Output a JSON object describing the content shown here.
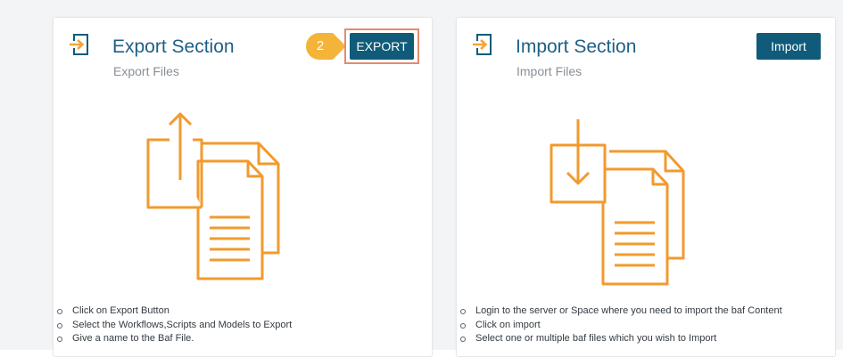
{
  "colors": {
    "title": "#1f5f86",
    "button_bg": "#0f5b79",
    "accent_orange": "#f4a53a",
    "highlight_border": "#e38b70"
  },
  "export_section": {
    "icon": "export-icon",
    "title": "Export Section",
    "subtitle": "Export Files",
    "button_label": "EXPORT",
    "step_badge": "2",
    "illustration_icon": "upload-documents-icon",
    "steps": [
      "Click on Export Button",
      "Select the Workflows,Scripts and Models to Export",
      "Give a name to the Baf File."
    ]
  },
  "import_section": {
    "icon": "import-icon",
    "title": "Import Section",
    "subtitle": "Import Files",
    "button_label": "Import",
    "illustration_icon": "download-documents-icon",
    "steps": [
      "Login to the server or Space where you need to import the baf Content",
      "Click on import",
      "Select one or multiple baf files which you wish to Import"
    ]
  }
}
